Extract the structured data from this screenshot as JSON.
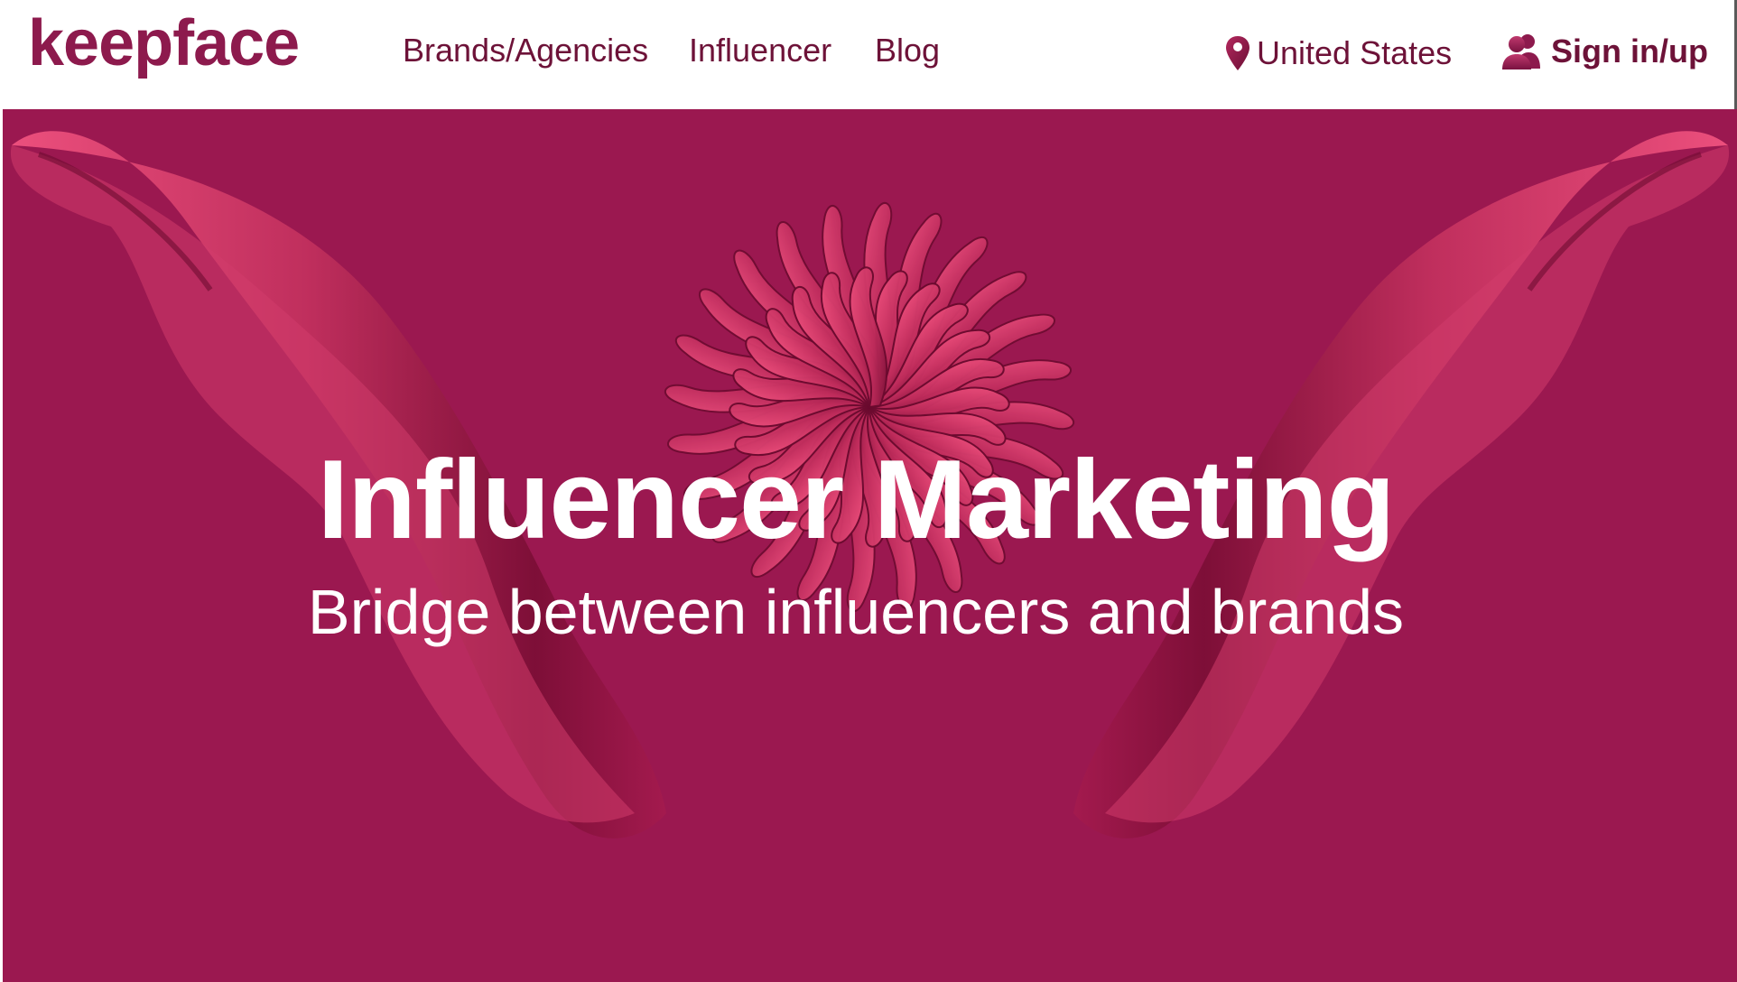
{
  "header": {
    "logo": "keepface",
    "nav": [
      {
        "label": "Brands/Agencies"
      },
      {
        "label": "Influencer"
      },
      {
        "label": "Blog"
      }
    ],
    "country": {
      "label": "United States",
      "icon": "location-pin-icon"
    },
    "signin": {
      "label": "Sign in/up",
      "icon": "users-icon"
    }
  },
  "hero": {
    "title": "Influencer Marketing",
    "subtitle": "Bridge between influencers and brands",
    "background_color": "#9b1850",
    "accent_color": "#e8487a"
  },
  "colors": {
    "brand": "#8d1a4d",
    "nav_text": "#6d1238",
    "header_bg": "#ffffff"
  }
}
